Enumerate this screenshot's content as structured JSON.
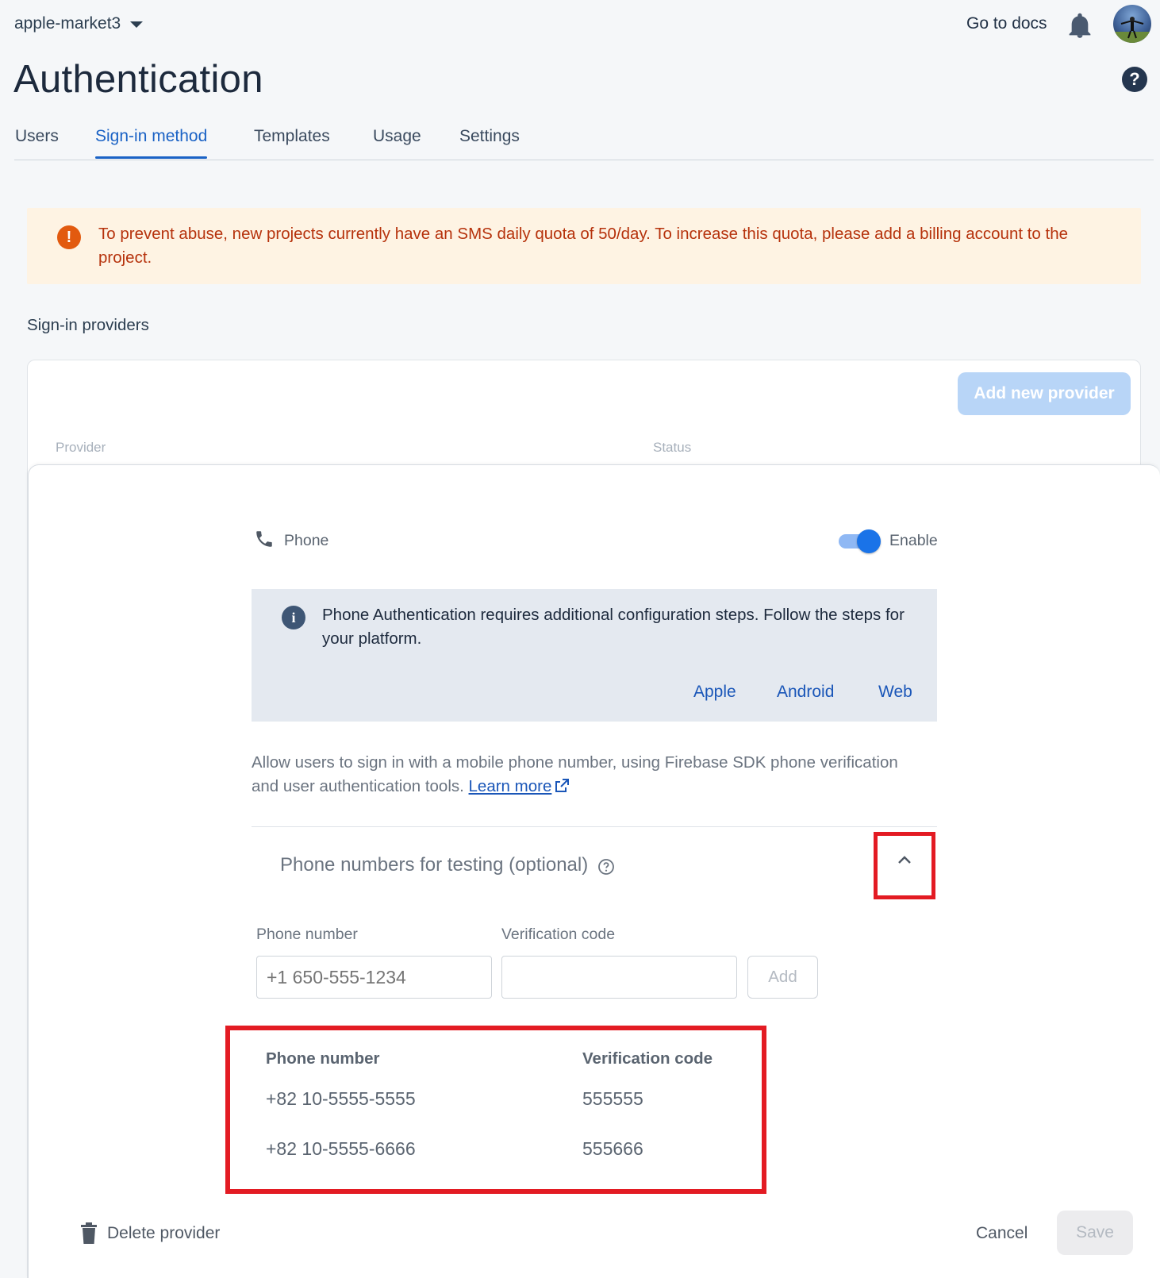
{
  "header": {
    "project_name": "apple-market3",
    "docs_link": "Go to docs",
    "page_title": "Authentication",
    "help_glyph": "?"
  },
  "tabs": [
    {
      "label": "Users",
      "active": false
    },
    {
      "label": "Sign-in method",
      "active": true
    },
    {
      "label": "Templates",
      "active": false
    },
    {
      "label": "Usage",
      "active": false
    },
    {
      "label": "Settings",
      "active": false
    }
  ],
  "warning": {
    "glyph": "!",
    "text": "To prevent abuse, new projects currently have an SMS daily quota of 50/day. To increase this quota, please add a billing account to the project.",
    "color": "#b6320c"
  },
  "providers": {
    "section_label": "Sign-in providers",
    "add_button": "Add new provider",
    "columns": {
      "provider": "Provider",
      "status": "Status"
    }
  },
  "phone_provider": {
    "name": "Phone",
    "enabled": true,
    "enable_label": "Enable",
    "info": {
      "glyph": "i",
      "text": "Phone Authentication requires additional configuration steps. Follow the steps for your platform.",
      "platforms": [
        "Apple",
        "Android",
        "Web"
      ]
    },
    "description": "Allow users to sign in with a mobile phone number, using Firebase SDK phone verification and user authentication tools.",
    "learn_more": "Learn more",
    "testing": {
      "title": "Phone numbers for testing (optional)",
      "phone_label": "Phone number",
      "code_label": "Verification code",
      "phone_placeholder": "+1 650-555-1234",
      "code_value": "",
      "add_button": "Add",
      "table_headers": {
        "phone": "Phone number",
        "code": "Verification code"
      },
      "rows": [
        {
          "phone": "+82 10-5555-5555",
          "code": "555555"
        },
        {
          "phone": "+82 10-5555-6666",
          "code": "555666"
        }
      ]
    }
  },
  "footer": {
    "delete_label": "Delete provider",
    "cancel_label": "Cancel",
    "save_label": "Save"
  },
  "colors": {
    "accent": "#1a73e8",
    "highlight": "#e31b23"
  }
}
